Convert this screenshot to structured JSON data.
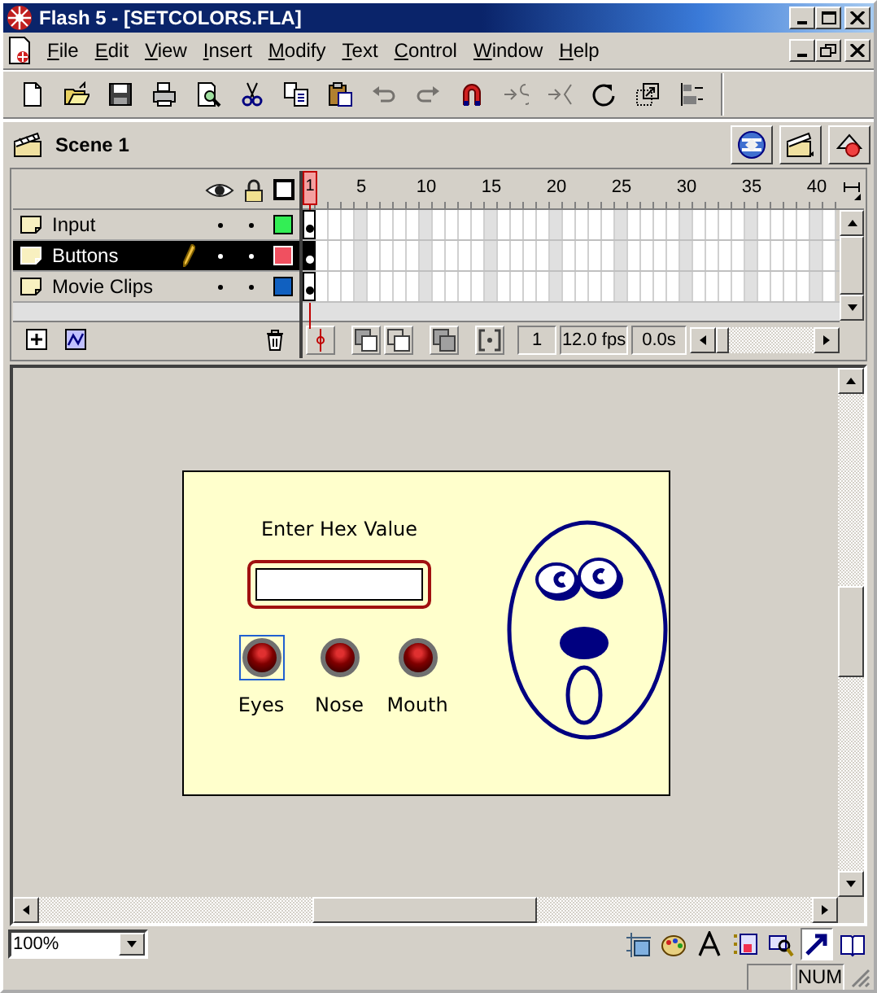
{
  "window": {
    "title": "Flash 5 - [SETCOLORS.FLA]"
  },
  "menu": [
    "File",
    "Edit",
    "View",
    "Insert",
    "Modify",
    "Text",
    "Control",
    "Window",
    "Help"
  ],
  "toolbar": [
    {
      "kind": "new",
      "disabled": false
    },
    {
      "kind": "open",
      "disabled": false
    },
    {
      "kind": "save",
      "disabled": false
    },
    {
      "kind": "print",
      "disabled": false
    },
    {
      "kind": "preview",
      "disabled": false
    },
    {
      "kind": "cut",
      "disabled": false
    },
    {
      "kind": "copy",
      "disabled": false
    },
    {
      "kind": "paste",
      "disabled": false
    },
    {
      "kind": "undo",
      "disabled": true
    },
    {
      "kind": "redo",
      "disabled": true
    },
    {
      "kind": "snap",
      "disabled": false
    },
    {
      "kind": "smooth",
      "disabled": true
    },
    {
      "kind": "straighten",
      "disabled": true
    },
    {
      "kind": "rotate",
      "disabled": false
    },
    {
      "kind": "scale",
      "disabled": false
    },
    {
      "kind": "align",
      "disabled": false
    }
  ],
  "scene": {
    "label": "Scene 1"
  },
  "timeline": {
    "ticks": [
      {
        "label": "1",
        "selected": true
      },
      {
        "label": "5",
        "selected": false
      },
      {
        "label": "10",
        "selected": false
      },
      {
        "label": "15",
        "selected": false
      },
      {
        "label": "20",
        "selected": false
      },
      {
        "label": "25",
        "selected": false
      },
      {
        "label": "30",
        "selected": false
      },
      {
        "label": "35",
        "selected": false
      },
      {
        "label": "40",
        "selected": false
      }
    ],
    "layers": [
      {
        "name": "Input",
        "selected": false,
        "editing": false,
        "color": "#33ee55"
      },
      {
        "name": "Buttons",
        "selected": true,
        "editing": true,
        "color": "#f05060"
      },
      {
        "name": "Movie Clips",
        "selected": false,
        "editing": false,
        "color": "#1060c0"
      }
    ],
    "current_frame": "1",
    "frame_rate": "12.0 fps",
    "elapsed_time": "0.0s"
  },
  "stage": {
    "prompt": "Enter Hex Value",
    "buttons": [
      {
        "label": "Eyes",
        "selected": true
      },
      {
        "label": "Nose",
        "selected": false
      },
      {
        "label": "Mouth",
        "selected": false
      }
    ]
  },
  "status": {
    "zoom": "100%",
    "num_lock": "NUM"
  },
  "launcher": [
    {
      "kind": "timeline",
      "selected": false
    },
    {
      "kind": "colors",
      "selected": false
    },
    {
      "kind": "character",
      "selected": false
    },
    {
      "kind": "instance",
      "selected": false
    },
    {
      "kind": "explorer",
      "selected": false
    },
    {
      "kind": "actions",
      "selected": true
    },
    {
      "kind": "library",
      "selected": false
    }
  ]
}
